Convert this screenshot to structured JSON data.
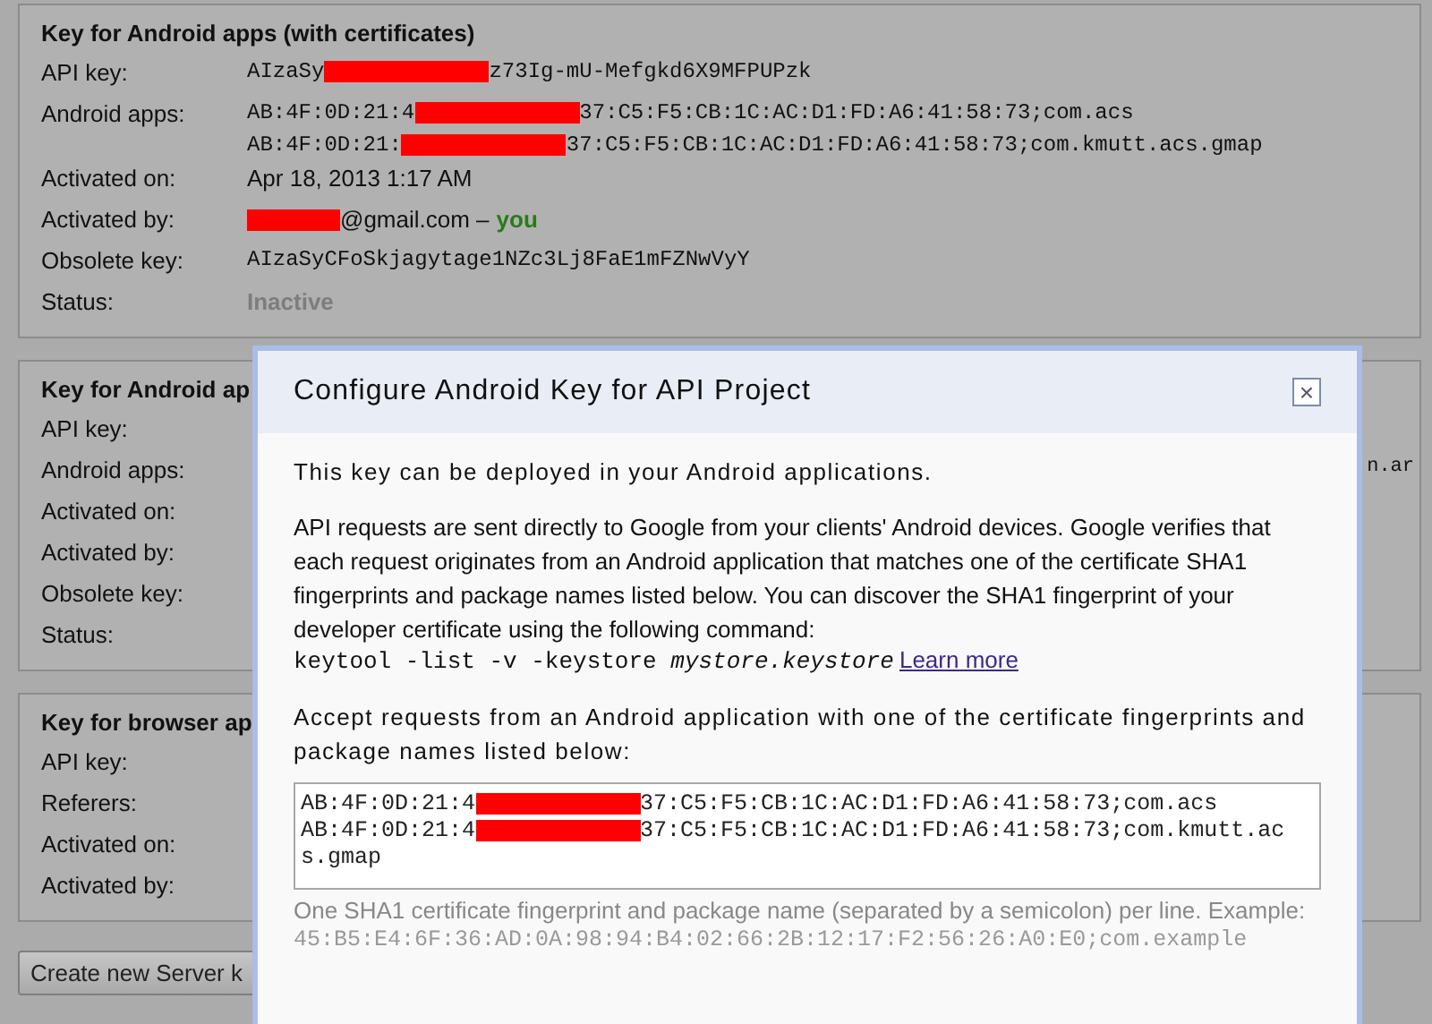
{
  "cards": [
    {
      "title": "Key for Android apps (with certificates)",
      "rows": [
        {
          "label": "API key:",
          "kind": "mono",
          "lines": [
            [
              {
                "kind": "plain",
                "text": "AIzaSy"
              },
              {
                "kind": "redaction"
              },
              {
                "kind": "plain",
                "text": "z73Ig-mU-Mefgkd6X9MFPUPzk"
              }
            ]
          ]
        },
        {
          "label": "Android apps:",
          "kind": "mono",
          "lines": [
            [
              {
                "kind": "plain",
                "text": "AB:4F:0D:21:4"
              },
              {
                "kind": "redaction"
              },
              {
                "kind": "plain",
                "text": "37:C5:F5:CB:1C:AC:D1:FD:A6:41:58:73;com.acs"
              }
            ],
            [
              {
                "kind": "plain",
                "text": "AB:4F:0D:21:"
              },
              {
                "kind": "redaction"
              },
              {
                "kind": "plain",
                "text": "37:C5:F5:CB:1C:AC:D1:FD:A6:41:58:73;com.kmutt.acs.gmap"
              }
            ]
          ]
        },
        {
          "label": "Activated on:",
          "kind": "sans",
          "lines": [
            [
              {
                "kind": "plain",
                "text": "Apr 18, 2013 1:17 AM"
              }
            ]
          ]
        },
        {
          "label": "Activated by:",
          "kind": "sans",
          "lines": [
            [
              {
                "kind": "redaction"
              },
              {
                "kind": "plain",
                "text": "@gmail.com –"
              },
              {
                "kind": "accent",
                "text": "you"
              }
            ]
          ]
        },
        {
          "label": "Obsolete key:",
          "kind": "mono",
          "lines": [
            [
              {
                "kind": "plain",
                "text": "AIzaSyCFoSkjagytage1NZc3Lj8FaE1mFZNwVyY"
              }
            ]
          ]
        },
        {
          "label": "Status:",
          "kind": "status",
          "lines": [
            [
              {
                "kind": "plain",
                "text": "Inactive"
              }
            ]
          ]
        }
      ]
    },
    {
      "title": "Key for Android ap",
      "rows": [
        {
          "label": "API key:",
          "kind": "mono"
        },
        {
          "label": "Android apps:",
          "kind": "mono",
          "lines": [
            [
              {
                "kind": "edge",
                "text": "n.ar"
              }
            ]
          ]
        },
        {
          "label": "Activated on:",
          "kind": "mono"
        },
        {
          "label": "Activated by:",
          "kind": "sans"
        },
        {
          "label": "Obsolete key:",
          "kind": "mono"
        },
        {
          "label": "Status:",
          "kind": "status"
        }
      ]
    },
    {
      "title": "Key for browser ap",
      "rows": [
        {
          "label": "API key:",
          "kind": "mono"
        },
        {
          "label": "Referers:",
          "kind": "sans"
        },
        {
          "label": "Activated on:",
          "kind": "sans"
        },
        {
          "label": "Activated by:",
          "kind": "sans"
        }
      ]
    }
  ],
  "create_button": "Create new Server k",
  "dialog": {
    "title": "Configure Android Key for API Project",
    "close": "×",
    "intro": "This key can be deployed in your Android applications.",
    "explanation": "API requests are sent directly to Google from your clients' Android devices. Google verifies that each request originates from an Android application that matches one of the certificate SHA1 fingerprints and package names listed below. You can discover the SHA1 fingerprint of your developer certificate using the following command:",
    "command": "keytool -list -v -keystore *mystore.keystore*",
    "learn_more": "Learn more",
    "accept_label": "Accept requests from an Android application with one of the certificate fingerprints and package names listed below:",
    "field_lines": [
      [
        {
          "kind": "plain",
          "text": "AB:4F:0D:21:4"
        },
        {
          "kind": "redaction"
        },
        {
          "kind": "plain",
          "text": "37:C5:F5:CB:1C:AC:D1:FD:A6:41:58:73;com.acs"
        }
      ],
      [
        {
          "kind": "plain",
          "text": "AB:4F:0D:21:4"
        },
        {
          "kind": "redaction"
        },
        {
          "kind": "plain",
          "text": "37:C5:F5:CB:1C:AC:D1:FD:A6:41:58:73;com.kmutt.ac"
        }
      ],
      [
        {
          "kind": "plain",
          "text": "s.gmap"
        }
      ]
    ],
    "help": "One SHA1 certificate fingerprint and package name (separated by a semicolon) per line. Example:",
    "example": "45:B5:E4:6F:36:AD:0A:98:94:B4:02:66:2B:12:17:F2:56:26:A0:E0;com.example"
  }
}
